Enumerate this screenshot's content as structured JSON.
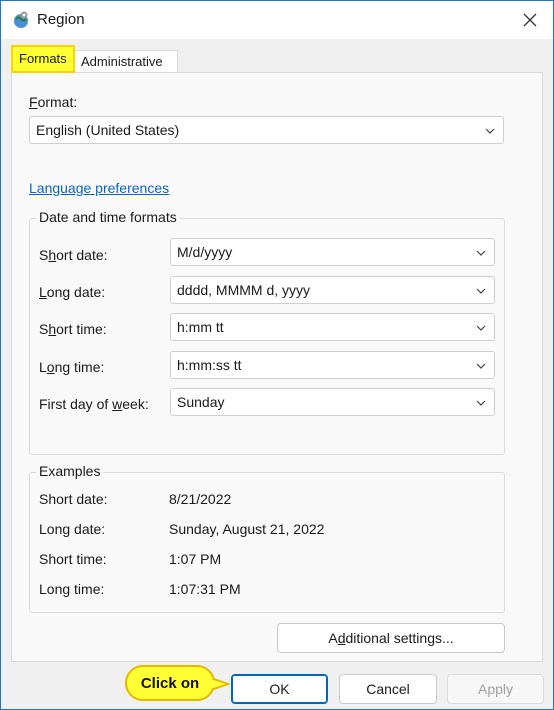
{
  "window": {
    "title": "Region"
  },
  "tabs": [
    {
      "label": "Formats"
    },
    {
      "label": "Administrative"
    }
  ],
  "formats": {
    "format_label_first": "F",
    "format_label_rest": "ormat:",
    "format_value": "English (United States)",
    "language_link": "Language preferences",
    "date_time_group": {
      "title": "Date and time formats",
      "rows": [
        {
          "label_pre": "S",
          "label_u": "h",
          "label_post": "ort date:",
          "value": "M/d/yyyy"
        },
        {
          "label_pre": "",
          "label_u": "L",
          "label_post": "ong date:",
          "value": "dddd, MMMM d, yyyy"
        },
        {
          "label_pre": "S",
          "label_u": "h",
          "label_post": "ort time:",
          "value": "h:mm tt"
        },
        {
          "label_pre": "L",
          "label_u": "o",
          "label_post": "ng time:",
          "value": "h:mm:ss tt"
        },
        {
          "label_pre": "First day of ",
          "label_u": "w",
          "label_post": "eek:",
          "value": "Sunday"
        }
      ]
    },
    "examples_group": {
      "title": "Examples",
      "rows": [
        {
          "label": "Short date:",
          "value": "8/21/2022"
        },
        {
          "label": "Long date:",
          "value": "Sunday, August 21, 2022"
        },
        {
          "label": "Short time:",
          "value": "1:07 PM"
        },
        {
          "label": "Long time:",
          "value": "1:07:31 PM"
        }
      ]
    },
    "additional_settings_pre": "A",
    "additional_settings_u": "d",
    "additional_settings_post": "ditional settings..."
  },
  "footer": {
    "ok_label": "OK",
    "cancel_label": "Cancel",
    "apply_label": "Apply"
  },
  "annotation": {
    "callout_text": "Click on",
    "color": "#ffff33"
  },
  "colors": {
    "accent": "#0067c0",
    "link": "#0a64c8",
    "highlight": "#ffff33"
  }
}
